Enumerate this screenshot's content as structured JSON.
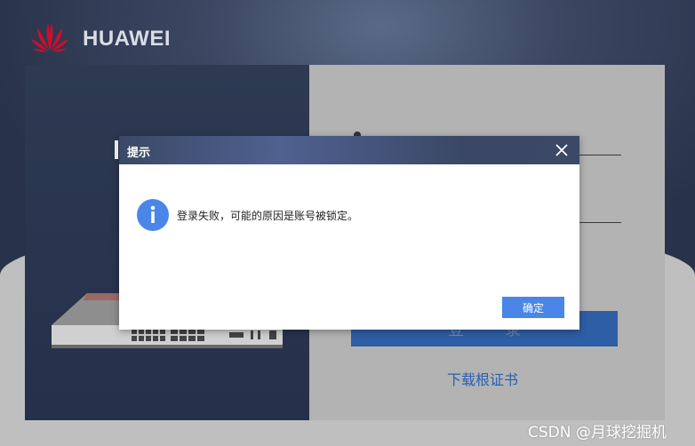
{
  "brand": {
    "name": "HUAWEI",
    "logo_icon": "huawei-flower-logo-icon",
    "logo_color": "#c8102e"
  },
  "login_panel": {
    "login_button_label": "登 录",
    "download_cert_link": "下载根证书",
    "accent_color": "#2e5ea6"
  },
  "dialog": {
    "title": "提示",
    "close_icon": "close-icon",
    "info_icon": "info-icon",
    "message": "登录失败，可能的原因是账号被锁定。",
    "ok_label": "确定",
    "ok_color": "#4a86e8"
  },
  "watermark": "CSDN @月球挖掘机"
}
